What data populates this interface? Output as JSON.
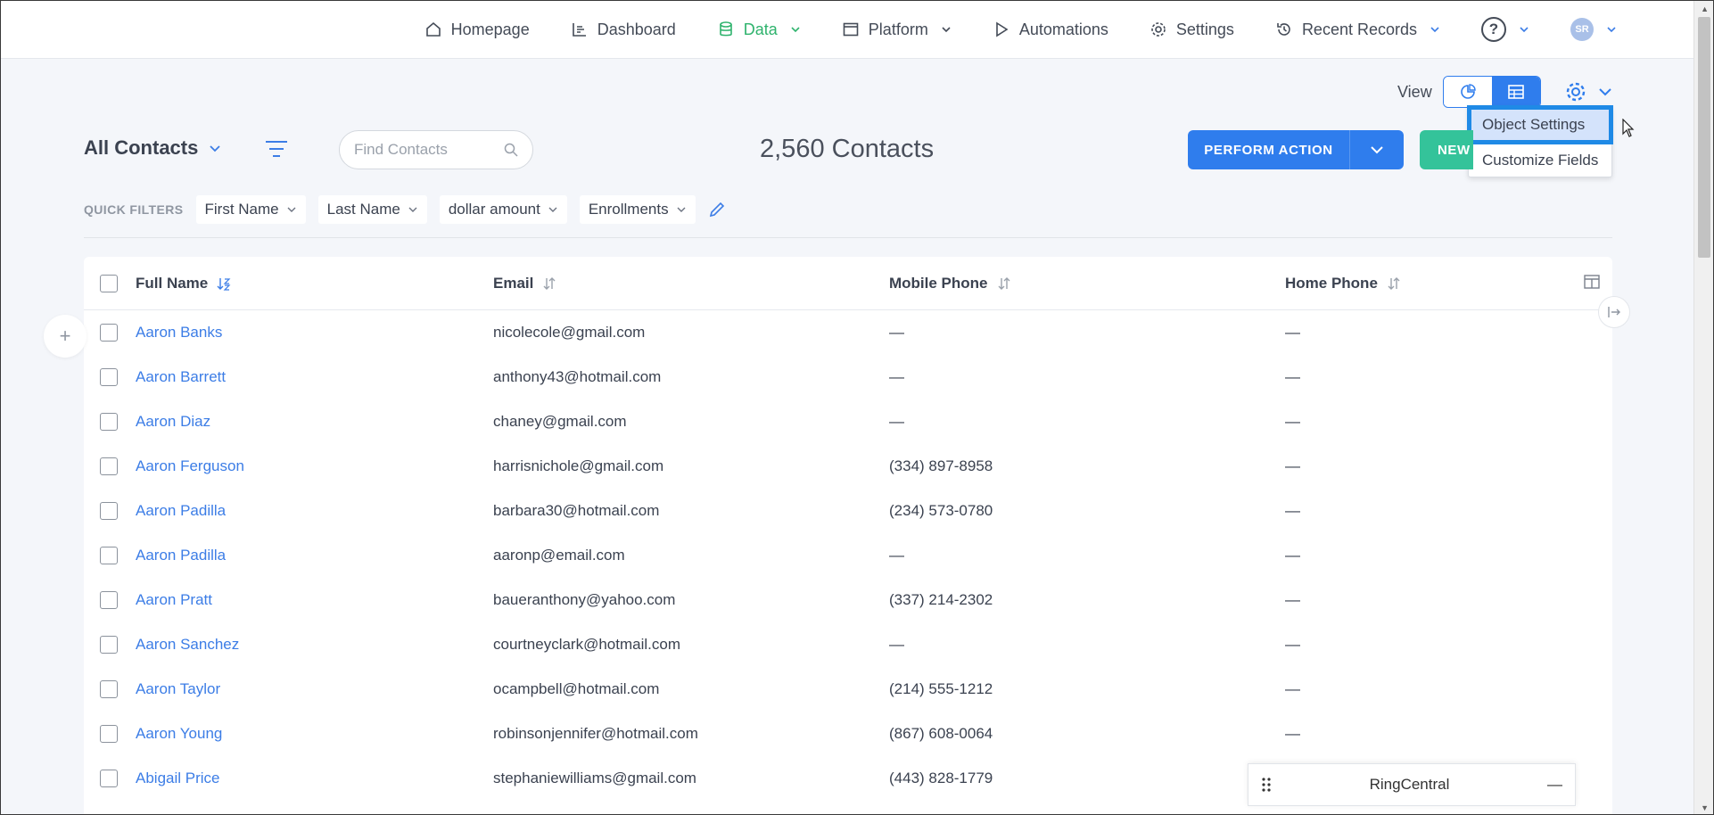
{
  "nav": {
    "items": [
      {
        "label": "Homepage",
        "icon": "home-icon"
      },
      {
        "label": "Dashboard",
        "icon": "dashboard-icon"
      },
      {
        "label": "Data",
        "icon": "database-icon",
        "active": true
      },
      {
        "label": "Platform",
        "icon": "window-icon"
      },
      {
        "label": "Automations",
        "icon": "play-icon"
      },
      {
        "label": "Settings",
        "icon": "gear-icon"
      },
      {
        "label": "Recent Records",
        "icon": "history-icon"
      }
    ],
    "help": "?",
    "avatar_initials": "SR"
  },
  "view": {
    "label": "View",
    "menu": {
      "items": [
        "Object Settings",
        "Customize Fields"
      ],
      "selected": "Object Settings"
    }
  },
  "list": {
    "title": "All Contacts",
    "search_placeholder": "Find Contacts",
    "count": "2,560 Contacts",
    "perform_action": "PERFORM ACTION",
    "new_label": "NEW"
  },
  "quick_filters": {
    "label": "QUICK FILTERS",
    "chips": [
      "First Name",
      "Last Name",
      "dollar amount",
      "Enrollments"
    ]
  },
  "table": {
    "columns": [
      "Full Name",
      "Email",
      "Mobile Phone",
      "Home Phone"
    ],
    "rows": [
      {
        "name": "Aaron Banks",
        "email": "nicolecole@gmail.com",
        "mobile": "—",
        "home": "—"
      },
      {
        "name": "Aaron Barrett",
        "email": "anthony43@hotmail.com",
        "mobile": "—",
        "home": "—"
      },
      {
        "name": "Aaron Diaz",
        "email": "chaney@gmail.com",
        "mobile": "—",
        "home": "—"
      },
      {
        "name": "Aaron Ferguson",
        "email": "harrisnichole@gmail.com",
        "mobile": "(334) 897-8958",
        "home": "—"
      },
      {
        "name": "Aaron Padilla",
        "email": "barbara30@hotmail.com",
        "mobile": "(234) 573-0780",
        "home": "—"
      },
      {
        "name": "Aaron Padilla",
        "email": "aaronp@email.com",
        "mobile": "—",
        "home": "—"
      },
      {
        "name": "Aaron Pratt",
        "email": "baueranthony@yahoo.com",
        "mobile": "(337) 214-2302",
        "home": "—"
      },
      {
        "name": "Aaron Sanchez",
        "email": "courtneyclark@hotmail.com",
        "mobile": "—",
        "home": "—"
      },
      {
        "name": "Aaron Taylor",
        "email": "ocampbell@hotmail.com",
        "mobile": "(214) 555-1212",
        "home": "—"
      },
      {
        "name": "Aaron Young",
        "email": "robinsonjennifer@hotmail.com",
        "mobile": "(867) 608-0064",
        "home": "—"
      },
      {
        "name": "Abigail Price",
        "email": "stephaniewilliams@gmail.com",
        "mobile": "(443) 828-1779",
        "home": ""
      }
    ]
  },
  "ringcentral": {
    "title": "RingCentral",
    "minimize": "—"
  },
  "colors": {
    "accent": "#2f7ded",
    "active_nav": "#2fb36d",
    "new_button": "#34c39a",
    "link": "#3c7de6"
  }
}
